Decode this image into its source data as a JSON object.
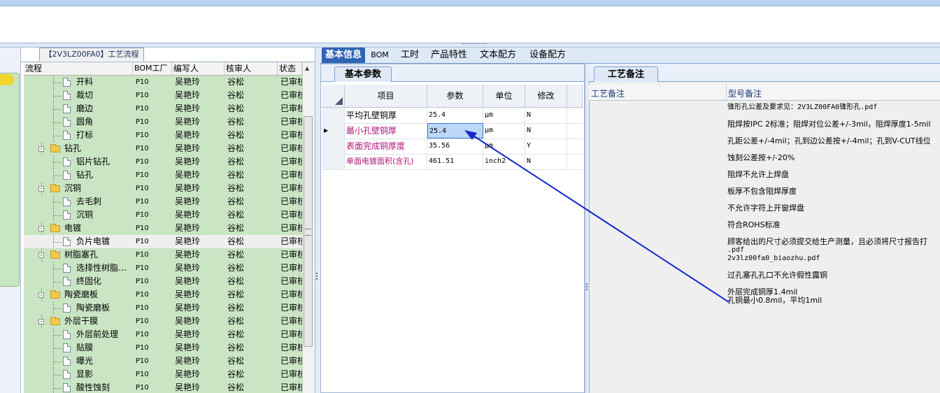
{
  "colors": {
    "tree_bg": "#c9e5c3",
    "active_tab": "#2f63b3",
    "arrow": "#1428c8",
    "highlight_text": "#b0167a"
  },
  "left": {
    "flow_tab": "【2V3LZ00FA0】工艺流程",
    "columns": [
      "流程",
      "BOM工厂",
      "编写人",
      "核审人",
      "状态"
    ],
    "rows": [
      {
        "type": "leaf",
        "name": "开料",
        "bom": "P10",
        "writer": "吴艳玲",
        "reviewer": "谷松",
        "status": "已审核"
      },
      {
        "type": "leaf",
        "name": "裁切",
        "bom": "P10",
        "writer": "吴艳玲",
        "reviewer": "谷松",
        "status": "已审核"
      },
      {
        "type": "leaf",
        "name": "磨边",
        "bom": "P10",
        "writer": "吴艳玲",
        "reviewer": "谷松",
        "status": "已审核"
      },
      {
        "type": "leaf",
        "name": "圆角",
        "bom": "P10",
        "writer": "吴艳玲",
        "reviewer": "谷松",
        "status": "已审核"
      },
      {
        "type": "leaf",
        "name": "打标",
        "bom": "P10",
        "writer": "吴艳玲",
        "reviewer": "谷松",
        "status": "已审核"
      },
      {
        "type": "folder",
        "name": "钻孔",
        "bom": "P10",
        "writer": "吴艳玲",
        "reviewer": "谷松",
        "status": "已审核"
      },
      {
        "type": "leaf",
        "name": "铝片钻孔",
        "bom": "P10",
        "writer": "吴艳玲",
        "reviewer": "谷松",
        "status": "已审核"
      },
      {
        "type": "leaf",
        "name": "钻孔",
        "bom": "P10",
        "writer": "吴艳玲",
        "reviewer": "谷松",
        "status": "已审核"
      },
      {
        "type": "folder",
        "name": "沉铜",
        "bom": "P10",
        "writer": "吴艳玲",
        "reviewer": "谷松",
        "status": "已审核"
      },
      {
        "type": "leaf",
        "name": "去毛刺",
        "bom": "P10",
        "writer": "吴艳玲",
        "reviewer": "谷松",
        "status": "已审核"
      },
      {
        "type": "leaf",
        "name": "沉铜",
        "bom": "P10",
        "writer": "吴艳玲",
        "reviewer": "谷松",
        "status": "已审核"
      },
      {
        "type": "folder",
        "name": "电镀",
        "bom": "P10",
        "writer": "吴艳玲",
        "reviewer": "谷松",
        "status": "已审核"
      },
      {
        "type": "leaf",
        "name": "负片电镀",
        "bom": "P10",
        "writer": "吴艳玲",
        "reviewer": "谷松",
        "status": "已审核",
        "selected": true
      },
      {
        "type": "folder",
        "name": "树脂塞孔",
        "bom": "P10",
        "writer": "吴艳玲",
        "reviewer": "谷松",
        "status": "已审核"
      },
      {
        "type": "leaf",
        "name": "选择性树脂…",
        "bom": "P10",
        "writer": "吴艳玲",
        "reviewer": "谷松",
        "status": "已审核"
      },
      {
        "type": "leaf",
        "name": "终固化",
        "bom": "P10",
        "writer": "吴艳玲",
        "reviewer": "谷松",
        "status": "已审核"
      },
      {
        "type": "folder",
        "name": "陶瓷磨板",
        "bom": "P10",
        "writer": "吴艳玲",
        "reviewer": "谷松",
        "status": "已审核"
      },
      {
        "type": "leaf",
        "name": "陶瓷磨板",
        "bom": "P10",
        "writer": "吴艳玲",
        "reviewer": "谷松",
        "status": "已审核"
      },
      {
        "type": "folder",
        "name": "外层干膜",
        "bom": "P10",
        "writer": "吴艳玲",
        "reviewer": "谷松",
        "status": "已审核"
      },
      {
        "type": "leaf",
        "name": "外层前处理",
        "bom": "P10",
        "writer": "吴艳玲",
        "reviewer": "谷松",
        "status": "已审核"
      },
      {
        "type": "leaf",
        "name": "贴膜",
        "bom": "P10",
        "writer": "吴艳玲",
        "reviewer": "谷松",
        "status": "已审核"
      },
      {
        "type": "leaf",
        "name": "曝光",
        "bom": "P10",
        "writer": "吴艳玲",
        "reviewer": "谷松",
        "status": "已审核"
      },
      {
        "type": "leaf",
        "name": "显影",
        "bom": "P10",
        "writer": "吴艳玲",
        "reviewer": "谷松",
        "status": "已审核"
      },
      {
        "type": "leaf",
        "name": "酸性蚀刻",
        "bom": "P10",
        "writer": "吴艳玲",
        "reviewer": "谷松",
        "status": "已审核"
      }
    ]
  },
  "tabs": [
    "基本信息",
    "BOM",
    "工时",
    "产品特性",
    "文本配方",
    "设备配方"
  ],
  "middle": {
    "tab": "基本参数",
    "columns": [
      "项目",
      "参数",
      "单位",
      "修改"
    ],
    "rows": [
      {
        "item": "平均孔壁铜厚",
        "value": "25.4",
        "unit": "μm",
        "mod": "N"
      },
      {
        "item": "最小孔壁铜厚",
        "value": "25.4",
        "unit": "μm",
        "mod": "N",
        "current": true
      },
      {
        "item": "表面完成铜厚度",
        "value": "35.56",
        "unit": "μm",
        "mod": "Y"
      },
      {
        "item": "单面电镀面积(含孔)",
        "value": "461.51",
        "unit": "inch2",
        "mod": "N"
      }
    ]
  },
  "right": {
    "tab": "工艺备注",
    "col1": "工艺备注",
    "col2": "型号备注",
    "notes": [
      "锥形孔公差及要求见：2V3LZ00FA0锥形孔.pdf",
      "阻焊按IPC 2标准；阻焊对位公差+/-3mil，阻焊厚度1-5mil",
      "孔距公差+/-4mil；孔到边公差按+/-4mil；孔到V-CUT线位",
      "蚀刻公差按+/-20%",
      "阻焊不允许上焊盘",
      "板厚不包含阻焊厚度",
      "不允许字符上开窗焊盘",
      "符合ROHS标准",
      "顾客给出的尺寸必须提交给生产测量，且必须将尺寸报告打",
      ".pdf",
      "2v3lz00fa0_biaozhu.pdf",
      "过孔塞孔孔口不允许假性露铜",
      "外层完成铜厚1.4mil",
      "孔铜最小0.8mil，平均1mil"
    ]
  }
}
